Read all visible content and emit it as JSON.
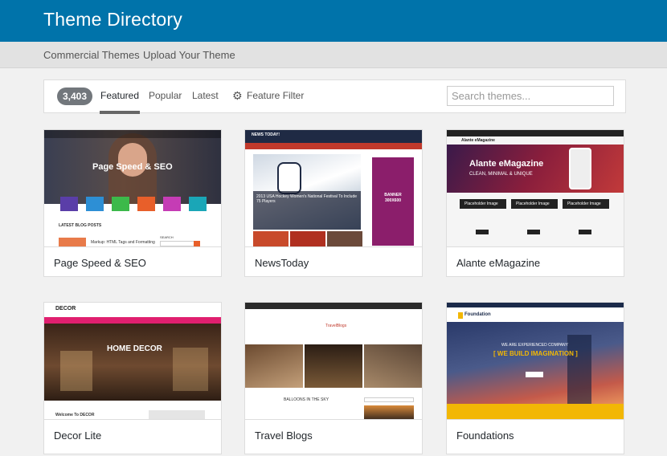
{
  "header": {
    "title": "Theme Directory"
  },
  "subnav": {
    "items": [
      "Commercial Themes",
      "Upload Your Theme"
    ]
  },
  "filter": {
    "count": "3,403",
    "tabs": [
      "Featured",
      "Popular",
      "Latest"
    ],
    "active_tab": "Featured",
    "feature_filter": "Feature Filter",
    "search_placeholder": "Search themes..."
  },
  "themes": [
    {
      "name": "Page Speed & SEO",
      "hero": "Page Speed & SEO",
      "section": "LATEST BLOG POSTS",
      "post": "Markup: HTML Tags and Formatting",
      "side": "SEARCH"
    },
    {
      "name": "NewsToday",
      "logo": "NEWS TODAY!",
      "headline": "2013 USA Hockey Women's National Festival To Include 75 Players",
      "banner": "BANNER 300X600"
    },
    {
      "name": "Alante eMagazine",
      "logo": "Alante eMagazine",
      "hero": "Alante eMagazine",
      "tagline": "CLEAN, MINIMAL & UNIQUE",
      "cards": [
        "Placeholder Image",
        "Placeholder Image",
        "Placeholder Image"
      ]
    },
    {
      "name": "Decor Lite",
      "logo": "DECOR",
      "hero": "HOME DECOR",
      "welcome": "Welcome To DECOR"
    },
    {
      "name": "Travel Blogs",
      "logo": "TravelBlogs",
      "post": "BALLOONS IN THE SKY"
    },
    {
      "name": "Foundations",
      "logo": "Foundation",
      "kicker": "WE ARE EXPERIENCED COMPANY",
      "hero": "[ WE BUILD IMAGINATION ]"
    }
  ],
  "colors": {
    "header": "#0073aa",
    "subnav": "#e2e2e2",
    "background": "#f1f1f1",
    "count_badge": "#72777c"
  }
}
